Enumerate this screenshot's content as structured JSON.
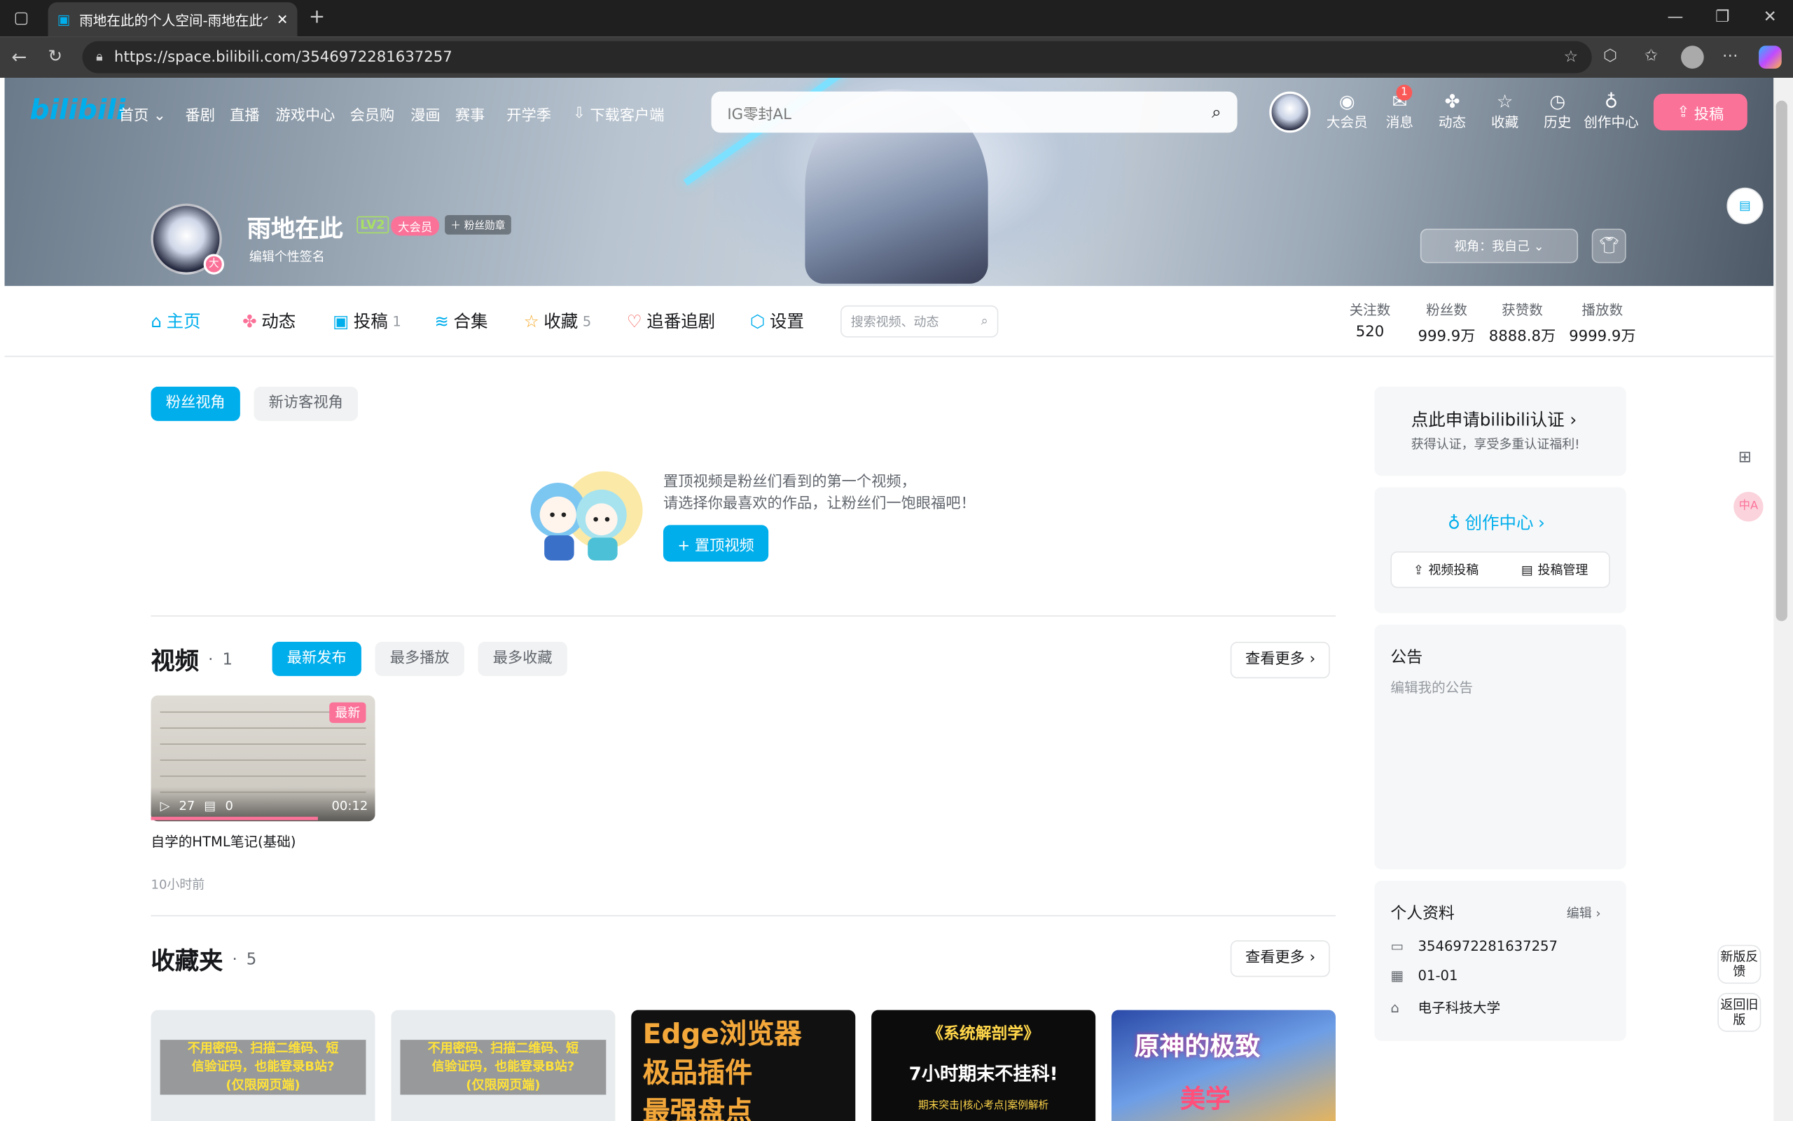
{
  "browser": {
    "tab_title": "雨地在此的个人空间-雨地在此个人",
    "url": "https://space.bilibili.com/3546972281637257"
  },
  "nav": {
    "logo": "bilibili",
    "items": [
      "首页",
      "番剧",
      "直播",
      "游戏中心",
      "会员购",
      "漫画",
      "赛事",
      "开学季"
    ],
    "download": "下载客户端",
    "search_text": "IG零封AL",
    "right_icons": [
      "大会员",
      "消息",
      "动态",
      "收藏",
      "历史",
      "创作中心"
    ],
    "message_badge": "1",
    "upload": "投稿"
  },
  "profile": {
    "name": "雨地在此",
    "level": "LV2",
    "vip": "大会员",
    "fan_medal": "粉丝勋章",
    "signature": "编辑个性签名",
    "avatar_badge": "大",
    "view_as": "视角：我自己"
  },
  "tabs": [
    {
      "label": "主页",
      "count": ""
    },
    {
      "label": "动态",
      "count": ""
    },
    {
      "label": "投稿",
      "count": "1"
    },
    {
      "label": "合集",
      "count": ""
    },
    {
      "label": "收藏",
      "count": "5"
    },
    {
      "label": "追番追剧",
      "count": ""
    },
    {
      "label": "设置",
      "count": ""
    }
  ],
  "tab_search_placeholder": "搜索视频、动态",
  "stats": [
    {
      "label": "关注数",
      "value": "520"
    },
    {
      "label": "粉丝数",
      "value": "999.9万"
    },
    {
      "label": "获赞数",
      "value": "8888.8万"
    },
    {
      "label": "播放数",
      "value": "9999.9万"
    }
  ],
  "view_toggle": [
    "粉丝视角",
    "新访客视角"
  ],
  "pin": {
    "line1": "置顶视频是粉丝们看到的第一个视频，",
    "line2": "请选择你最喜欢的作品，让粉丝们一饱眼福吧！",
    "button": "+ 置顶视频"
  },
  "videos": {
    "title": "视频",
    "count": "1",
    "sorts": [
      "最新发布",
      "最多播放",
      "最多收藏"
    ],
    "more": "查看更多",
    "item": {
      "title": "自学的HTML笔记(基础)",
      "plays": "27",
      "danmaku": "0",
      "duration": "00:12",
      "badge": "最新",
      "time": "10小时前"
    }
  },
  "favorites": {
    "title": "收藏夹",
    "count": "5",
    "more": "查看更多",
    "covers": [
      {
        "line1": "不用密码、扫描二维码、短",
        "line2": "信验证码，也能登录B站?",
        "line3": "(仅限网页端)"
      },
      {
        "line1": "不用密码、扫描二维码、短",
        "line2": "信验证码，也能登录B站?",
        "line3": "(仅限网页端)"
      },
      {
        "line1": "Edge浏览器",
        "line2": "极品插件",
        "line3": "最强盘点"
      },
      {
        "line1": "《系统解剖学》",
        "line2": "7小时期末不挂科!",
        "line3": "期末突击|核心考点|案例解析"
      },
      {
        "line1": "原神的极致",
        "line2": "美学",
        "line3": ""
      }
    ]
  },
  "sidebar": {
    "verify_title": "点此申请bilibili认证",
    "verify_sub": "获得认证，享受多重认证福利!",
    "creator": "创作中心",
    "creator_btn1": "视频投稿",
    "creator_btn2": "投稿管理",
    "notice_title": "公告",
    "notice_placeholder": "编辑我的公告",
    "info_title": "个人资料",
    "info_edit": "编辑",
    "uid": "3546972281637257",
    "birthday": "01-01",
    "school": "电子科技大学"
  },
  "float": {
    "feedback": "新版反馈",
    "old": "返回旧版"
  },
  "colors": {
    "accent": "#00aeec",
    "pink": "#fb7299"
  }
}
